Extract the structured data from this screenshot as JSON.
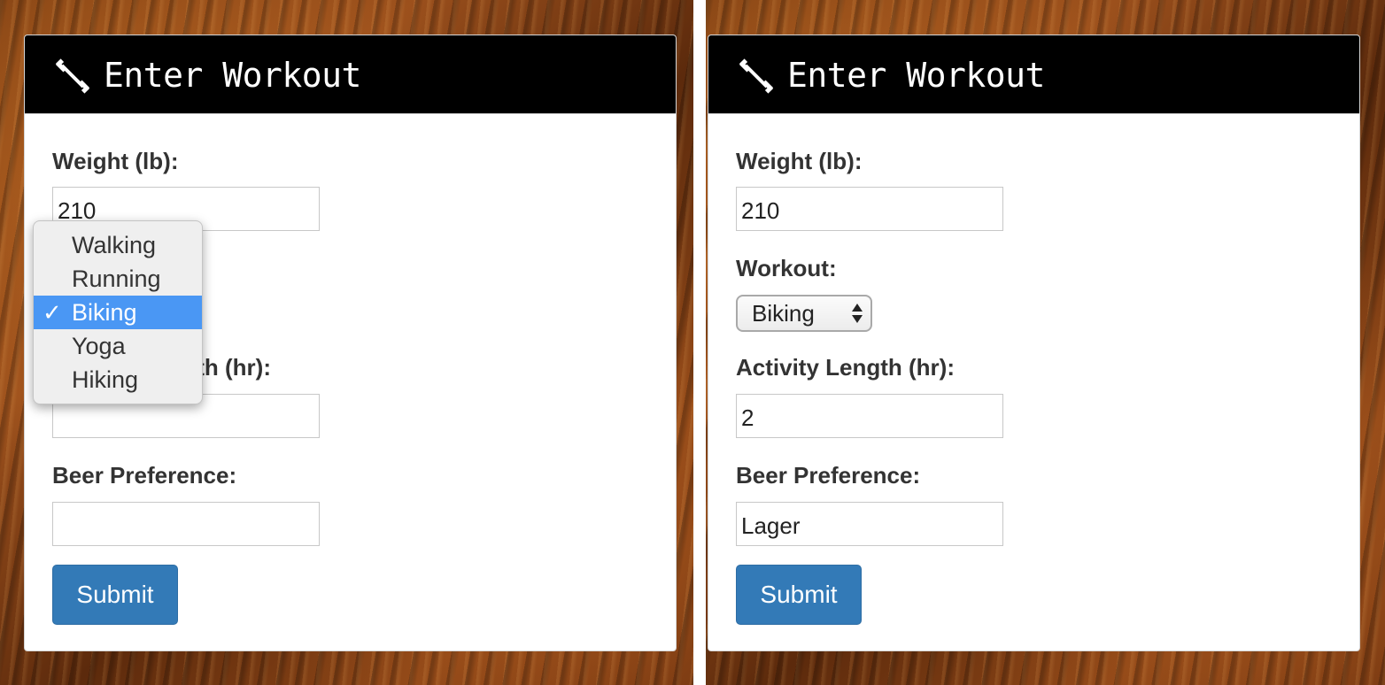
{
  "left_panel": {
    "title": "Enter Workout",
    "weight_label": "Weight (lb):",
    "weight_value": "210",
    "workout_dropdown": {
      "options": [
        {
          "label": "Walking",
          "selected": false
        },
        {
          "label": "Running",
          "selected": false
        },
        {
          "label": "Biking",
          "selected": true
        },
        {
          "label": "Yoga",
          "selected": false
        },
        {
          "label": "Hiking",
          "selected": false
        }
      ],
      "check_glyph": "✓"
    },
    "activity_label": "Activity Length (hr):",
    "activity_value": "",
    "beer_label": "Beer Preference:",
    "beer_value": "",
    "submit_label": "Submit"
  },
  "right_panel": {
    "title": "Enter Workout",
    "weight_label": "Weight (lb):",
    "weight_value": "210",
    "workout_label": "Workout:",
    "workout_selected": "Biking",
    "activity_label": "Activity Length (hr):",
    "activity_value": "2",
    "beer_label": "Beer Preference:",
    "beer_value": "Lager",
    "submit_label": "Submit"
  },
  "colors": {
    "header_bg": "#000000",
    "button_bg": "#337ab7",
    "selected_option_bg": "#4a97f4"
  },
  "icons": {
    "header_icon": "dumbbell-icon",
    "select_arrows": "up-down-arrows-icon"
  }
}
